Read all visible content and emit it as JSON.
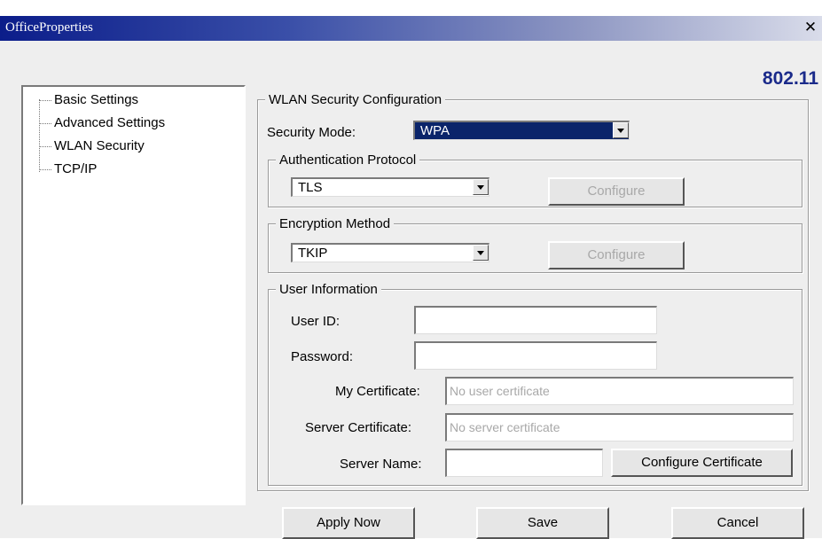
{
  "window": {
    "title": "OfficeProperties",
    "close_glyph": "✕"
  },
  "brand": "802.11",
  "sidebar": {
    "items": [
      {
        "label": "Basic Settings"
      },
      {
        "label": "Advanced Settings"
      },
      {
        "label": "WLAN Security"
      },
      {
        "label": "TCP/IP"
      }
    ]
  },
  "security": {
    "group_title": "WLAN Security Configuration",
    "mode_label": "Security Mode:",
    "mode_value": "WPA",
    "auth": {
      "group_title": "Authentication Protocol",
      "value": "TLS",
      "configure_label": "Configure"
    },
    "encryption": {
      "group_title": "Encryption Method",
      "value": "TKIP",
      "configure_label": "Configure"
    },
    "user": {
      "group_title": "User Information",
      "user_id_label": "User ID:",
      "user_id_value": "",
      "password_label": "Password:",
      "password_value": "",
      "my_cert_label": "My Certificate:",
      "my_cert_placeholder": "No user certificate",
      "server_cert_label": "Server Certificate:",
      "server_cert_placeholder": "No server certificate",
      "server_name_label": "Server Name:",
      "server_name_value": "",
      "configure_cert_label": "Configure Certificate"
    }
  },
  "footer": {
    "apply_label": "Apply Now",
    "save_label": "Save",
    "cancel_label": "Cancel"
  },
  "colors": {
    "title_bar": "#0b1d8a",
    "selection": "#0a246a",
    "brand": "#1a2a8a"
  }
}
